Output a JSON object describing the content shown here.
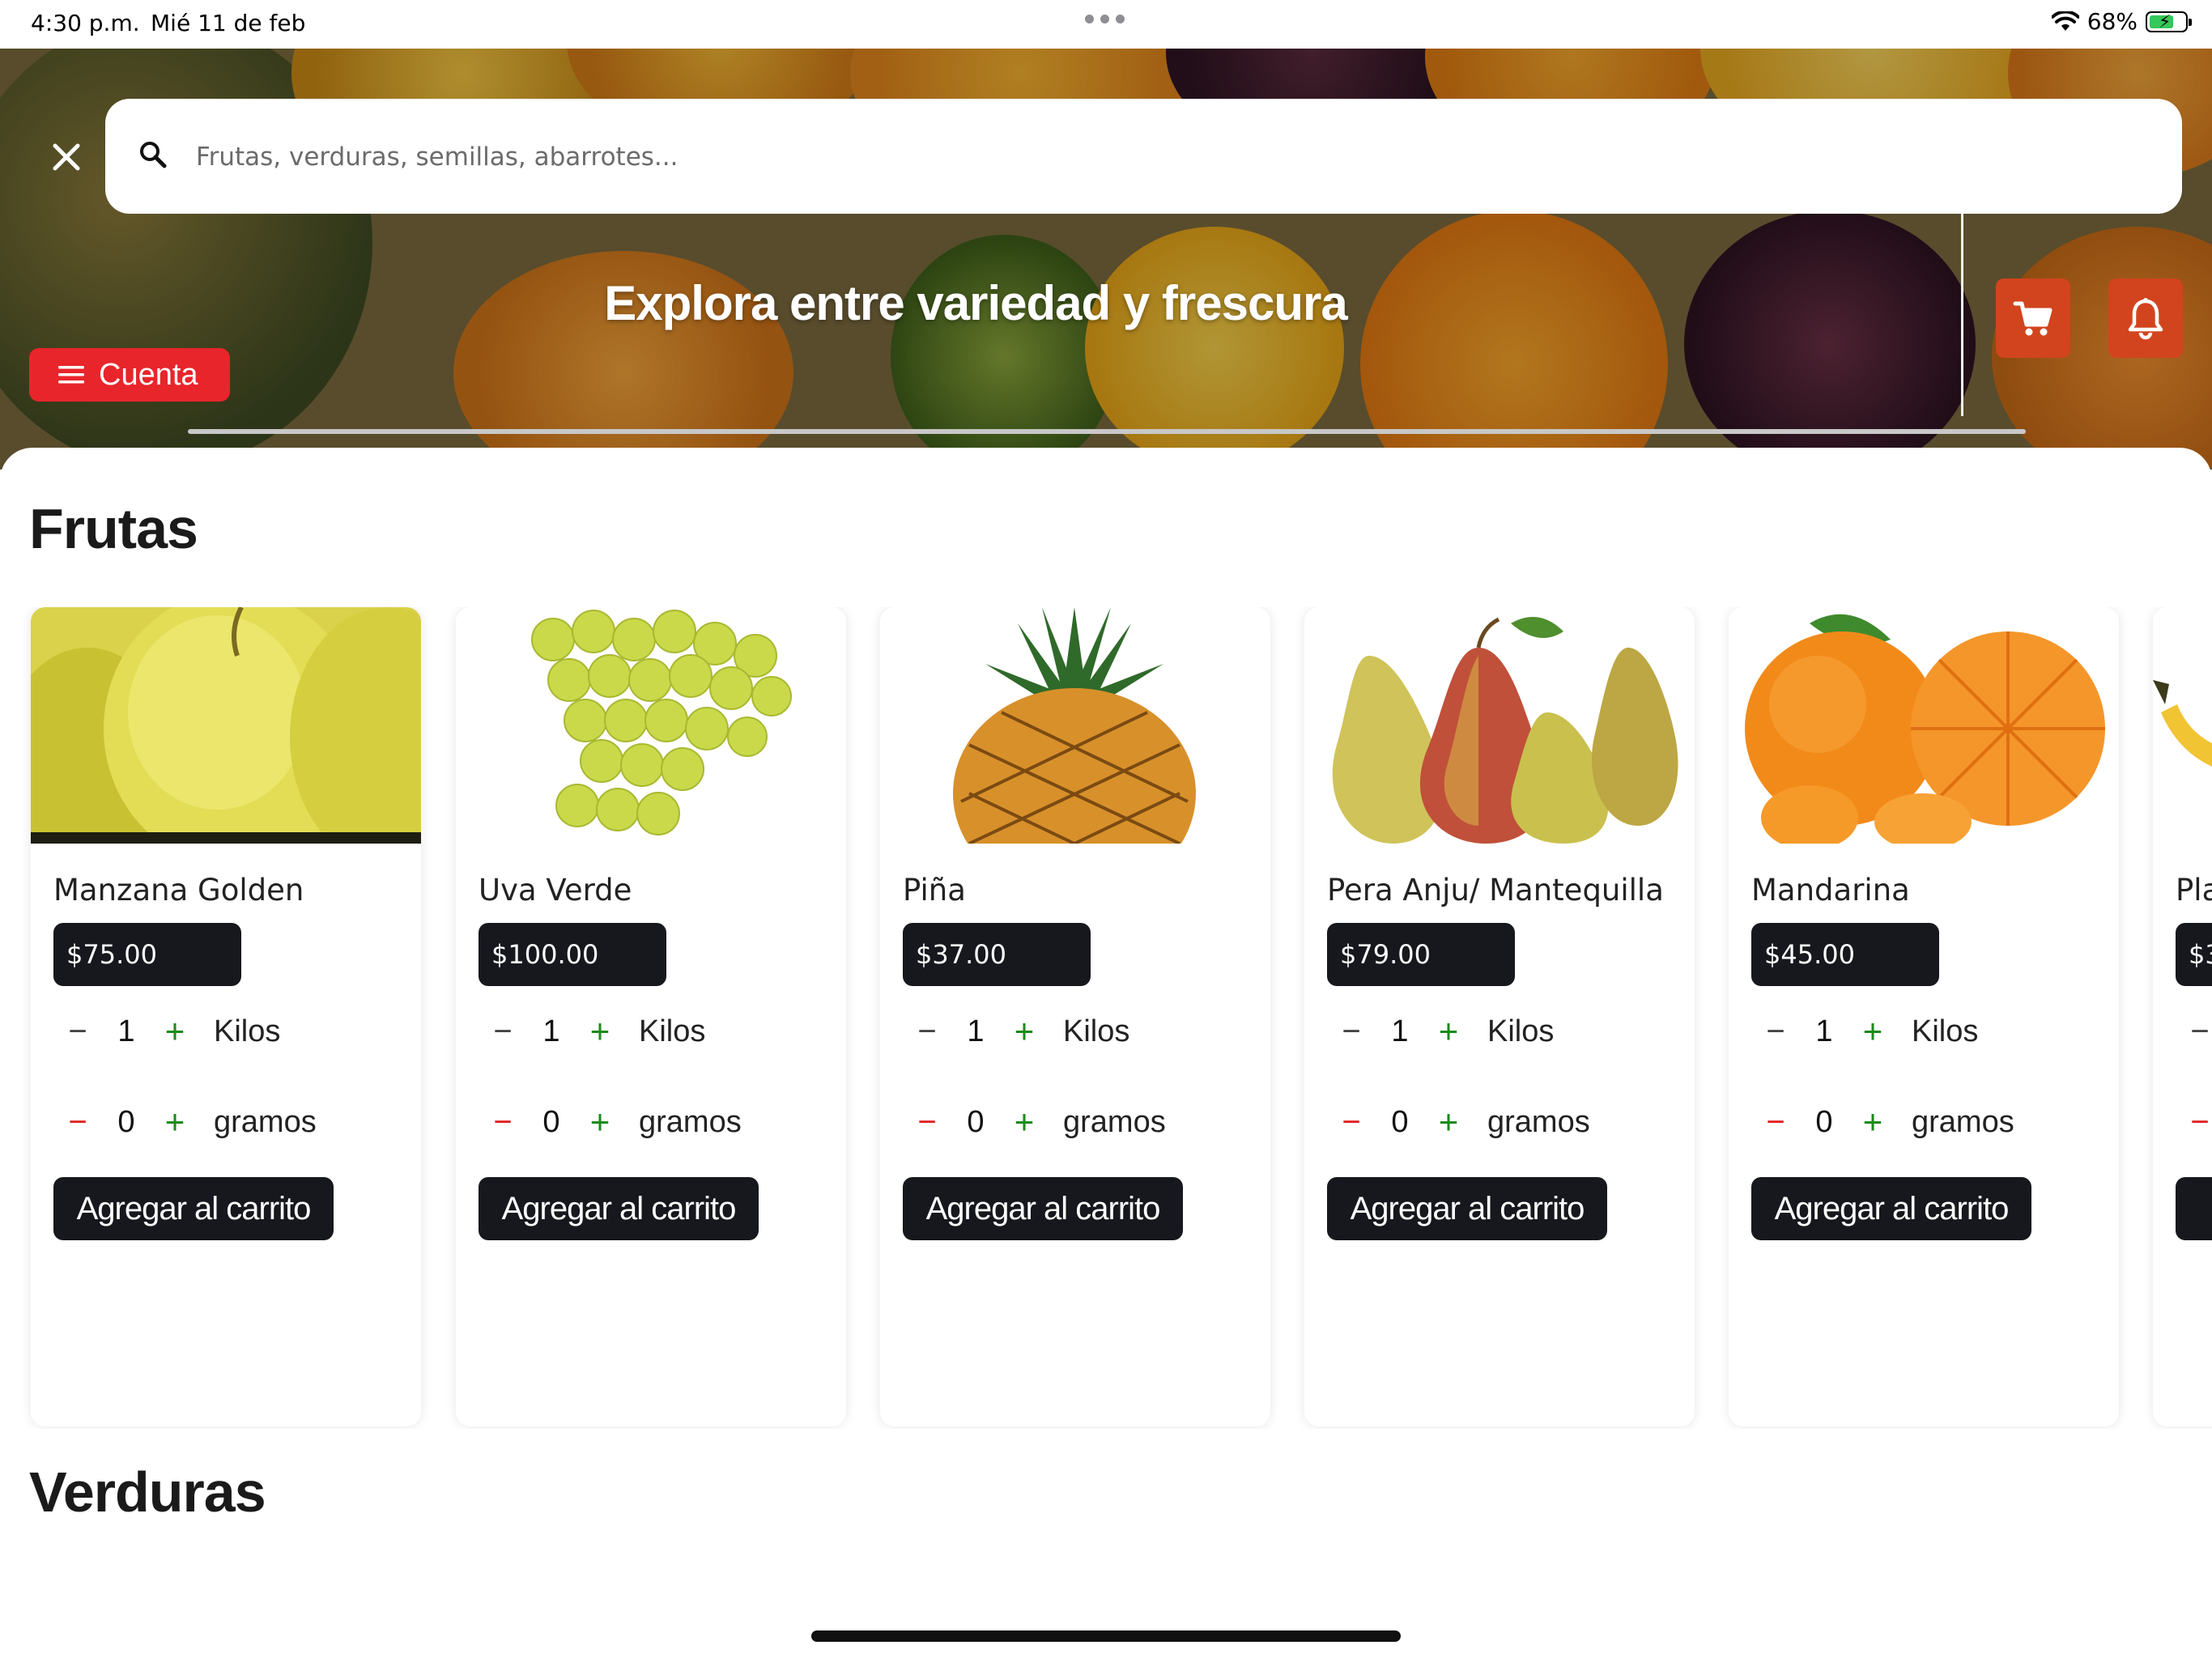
{
  "status_bar": {
    "time": "4:30 p.m.",
    "date": "Mié 11 de feb",
    "battery": "68%",
    "battery_level": 0.68
  },
  "header": {
    "search_placeholder": "Frutas, verduras, semillas, abarrotes...",
    "banner_title": "Explora entre variedad y frescura",
    "account_label": "Cuenta",
    "cart_icon": "cart-icon",
    "bell_icon": "bell-icon",
    "close_icon": "close-icon"
  },
  "colors": {
    "accent_red": "#e8252b",
    "action_orange": "#d2441d",
    "dark_button": "#16181d",
    "plus_green": "#1a8a1a",
    "minus_red": "#e02424"
  },
  "sections": [
    {
      "title": "Frutas"
    },
    {
      "title": "Verduras"
    }
  ],
  "products": [
    {
      "name": "Manzana Golden",
      "price": "$75.00",
      "kilos": "1",
      "gramos": "0",
      "kilos_unit": "Kilos",
      "gramos_unit": "gramos",
      "add_label": "Agregar al carrito",
      "image": "golden-apples-image"
    },
    {
      "name": "Uva Verde",
      "price": "$100.00",
      "kilos": "1",
      "gramos": "0",
      "kilos_unit": "Kilos",
      "gramos_unit": "gramos",
      "add_label": "Agregar al carrito",
      "image": "green-grapes-image"
    },
    {
      "name": "Piña",
      "price": "$37.00",
      "kilos": "1",
      "gramos": "0",
      "kilos_unit": "Kilos",
      "gramos_unit": "gramos",
      "add_label": "Agregar al carrito",
      "image": "pineapple-image"
    },
    {
      "name": "Pera Anju/ Mantequilla",
      "price": "$79.00",
      "kilos": "1",
      "gramos": "0",
      "kilos_unit": "Kilos",
      "gramos_unit": "gramos",
      "add_label": "Agregar al carrito",
      "image": "pears-image"
    },
    {
      "name": "Mandarina",
      "price": "$45.00",
      "kilos": "1",
      "gramos": "0",
      "kilos_unit": "Kilos",
      "gramos_unit": "gramos",
      "add_label": "Agregar al carrito",
      "image": "mandarins-image"
    },
    {
      "name": "Pla",
      "price": "$3",
      "image": "banana-image"
    }
  ],
  "symbols": {
    "minus": "−",
    "plus": "+"
  }
}
